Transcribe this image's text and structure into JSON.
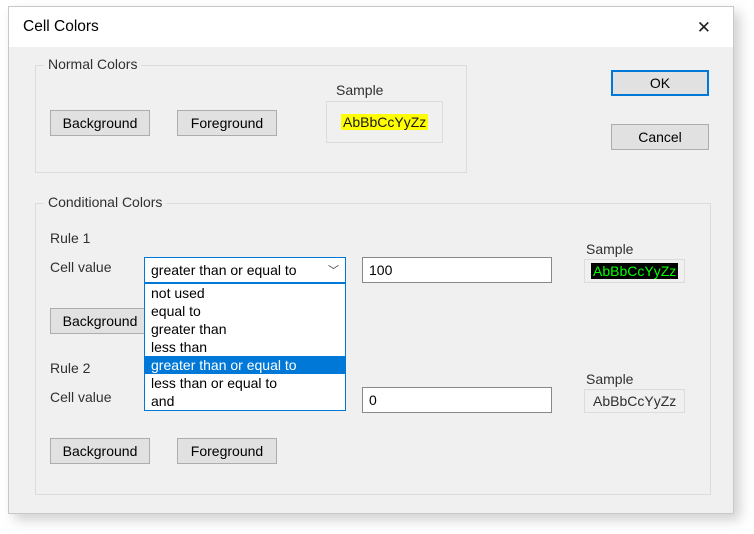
{
  "dialog": {
    "title": "Cell Colors"
  },
  "buttons": {
    "ok": "OK",
    "cancel": "Cancel"
  },
  "normal": {
    "group_label": "Normal Colors",
    "background_btn": "Background",
    "foreground_btn": "Foreground",
    "sample_label": "Sample",
    "sample_text": "AbBbCcYyZz"
  },
  "conditional": {
    "group_label": "Conditional Colors",
    "rule1": {
      "heading": "Rule 1",
      "cell_value_label": "Cell value",
      "combo_selected": "greater than or equal to",
      "value": "100",
      "sample_label": "Sample",
      "sample_text": "AbBbCcYyZz",
      "background_btn": "Background"
    },
    "rule2": {
      "heading": "Rule 2",
      "cell_value_label": "Cell value",
      "value": "0",
      "sample_label": "Sample",
      "sample_text": "AbBbCcYyZz",
      "background_btn": "Background",
      "foreground_btn": "Foreground"
    },
    "dropdown_options": {
      "o0": "not used",
      "o1": "equal to",
      "o2": "greater than",
      "o3": "less than",
      "o4": "greater than or equal to",
      "o5": "less than or equal to",
      "o6": "and"
    }
  }
}
